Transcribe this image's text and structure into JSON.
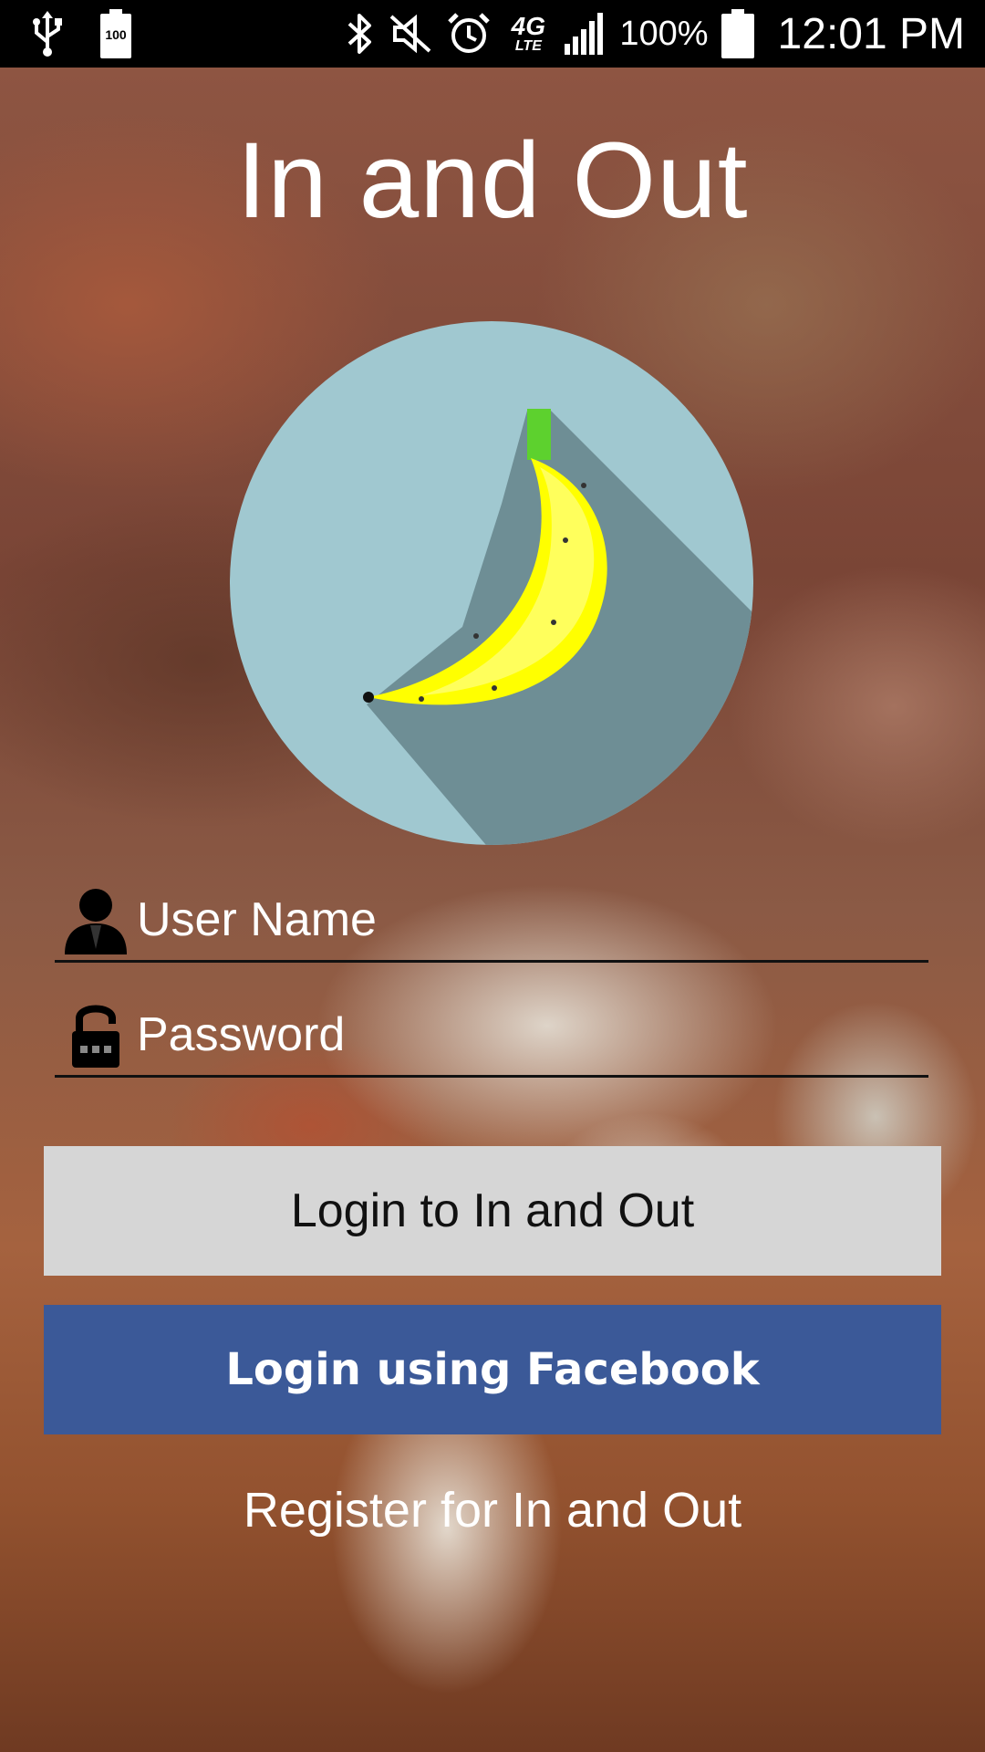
{
  "status_bar": {
    "battery_badge": "100",
    "network_label": "4G",
    "network_sub": "LTE",
    "battery_percent": "100%",
    "time": "12:01 PM"
  },
  "app": {
    "title": "In and Out"
  },
  "form": {
    "username_placeholder": "User Name",
    "password_placeholder": "Password"
  },
  "buttons": {
    "login_label": "Login to In and Out",
    "facebook_label": "Login using Facebook",
    "register_label": "Register for In and Out"
  },
  "colors": {
    "facebook_blue": "#3b5998",
    "login_gray": "#d6d6d6",
    "logo_circle": "#a0c8d0",
    "banana_yellow": "#ffff00"
  },
  "icons": [
    "usb-icon",
    "battery-status-icon",
    "bluetooth-icon",
    "mute-icon",
    "alarm-icon",
    "signal-icon",
    "battery-icon",
    "user-icon",
    "lock-icon",
    "banana-logo"
  ]
}
